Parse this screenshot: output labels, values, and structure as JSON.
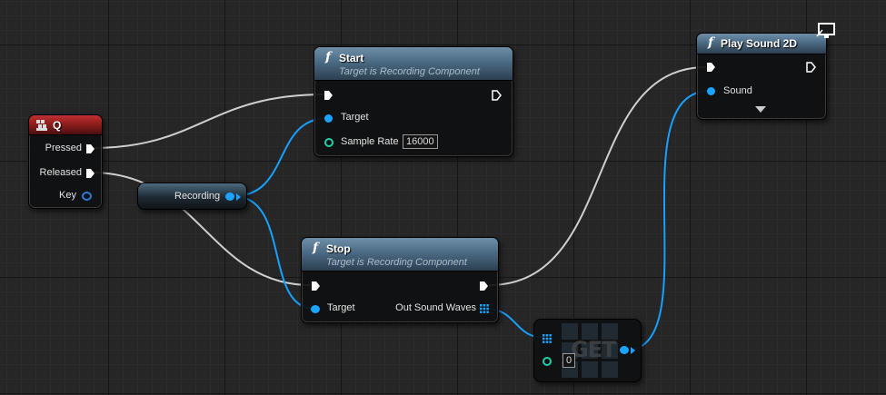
{
  "event_node": {
    "title": "Q",
    "icon": "keyboard-icon",
    "pins": [
      "Pressed",
      "Released",
      "Key"
    ]
  },
  "start_node": {
    "title": "Start",
    "subtitle": "Target is Recording Component",
    "target_label": "Target",
    "sample_rate_label": "Sample Rate",
    "sample_rate_value": "16000"
  },
  "recording_node": {
    "label": "Recording"
  },
  "stop_node": {
    "title": "Stop",
    "subtitle": "Target is Recording Component",
    "target_label": "Target",
    "output_label": "Out Sound Waves"
  },
  "get_node": {
    "title": "GET",
    "index_value": "0"
  },
  "play_node": {
    "title": "Play Sound 2D",
    "sound_label": "Sound",
    "icon": "monitor-icon"
  },
  "colors": {
    "exec": "#ffffff",
    "object_pin": "#1aa3ff",
    "int_pin": "#1fd1a8",
    "key_pin": "#2d7bd6",
    "wire_exec": "#cfcfcf",
    "wire_object": "#16a0ff",
    "function_header": "#4b6a84",
    "event_header": "#8a1b1b"
  }
}
